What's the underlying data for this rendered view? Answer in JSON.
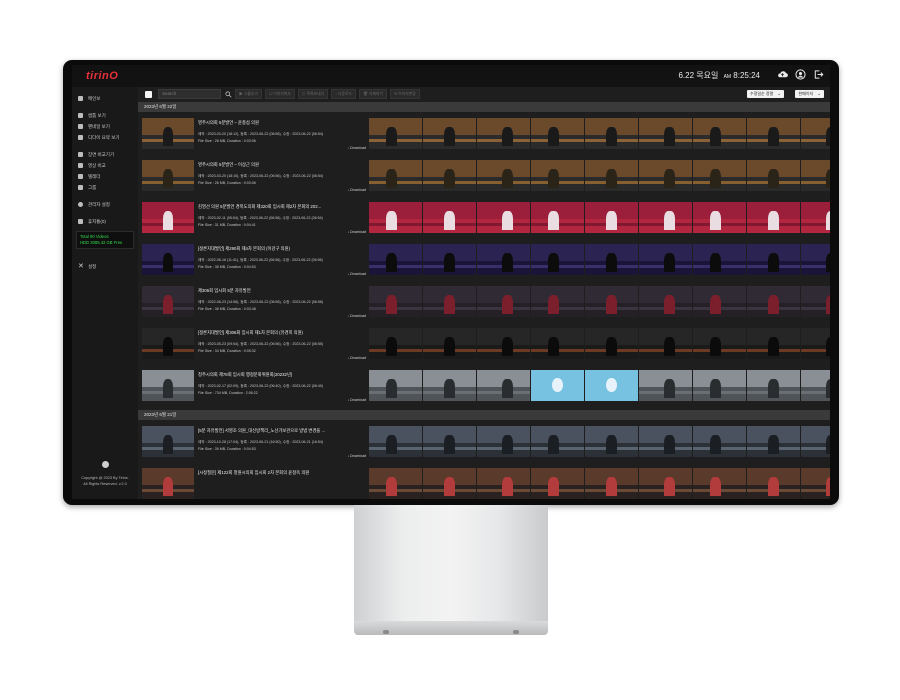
{
  "app": {
    "logo": "tirinO",
    "clock": {
      "date": "6.22 목요일",
      "ampm": "AM",
      "time": "8:25:24"
    }
  },
  "sidebar": {
    "items": [
      {
        "label": "메인보"
      },
      {
        "label": "썸톱 보기"
      },
      {
        "label": "팬네일 보기"
      },
      {
        "label": "디다이 요약 보기"
      },
      {
        "label": "장면 비교기기"
      },
      {
        "label": "영상 비교"
      },
      {
        "label": "텔레더"
      },
      {
        "label": "그룹"
      },
      {
        "label": "관리자 설정"
      },
      {
        "label": "휴지통(0)"
      }
    ],
    "stats": [
      "Total 90 Videos",
      "HDD 3085.42 GB Free"
    ],
    "settings_label": "설정",
    "copyright": [
      "Copyright @ 2023 By Tirins.",
      "All Rights Reserved. v.2.0"
    ]
  },
  "toolbar": {
    "search_placeholder": "Search",
    "buttons": [
      "▶ 그룹추가",
      "☐ 이미지복사",
      "▤ 목록보내기",
      "↓ 다운로드",
      "🗑 삭제하기",
      "⟲ 이미지변경"
    ],
    "sort_select": "수정일순 정렬",
    "view_select": "한페이지"
  },
  "sections": [
    {
      "date": "2023년 6월 22일",
      "rows": [
        {
          "title": "영주시의회 5분발언 – 윤충섭 의원",
          "meta": "제작 : 2023-03-20 (18:12), 등록 : 2023-06-22 (06:56), 수정 : 2023-06-22 (06:54)",
          "size": "File Size : 26 MB, Duration : 0:03:06",
          "download": "↓ Download"
        },
        {
          "title": "영주시의회 5분발언 – 이상근 의원",
          "meta": "제작 : 2023-03-20 (18:10), 등록 : 2023-06-22 (06:56), 수정 : 2023-06-22 (06:54)",
          "size": "File Size : 26 MB, Duration : 0:03:06",
          "download": "↓ Download"
        },
        {
          "title": "김영선 의원 5분발언 경복도의회 제320회 임시회 제2차 본회의 202...",
          "meta": "제작 : 2023-02-11 (05:54), 등록 : 2023-06-22 (06:56), 수정 : 2023-06-22 (06:54)",
          "size": "File Size : 31 MB, Duration : 0:04:41",
          "download": "↓ Download"
        },
        {
          "title": "[정론지대발언] 제290회 제4차 본회의 (이강구 의원)",
          "meta": "제작 : 2022-06-16 (11:41), 등록 : 2023-06-22 (06:56), 수정 : 2023-06-22 (06:56)",
          "size": "File Size : 38 MB, Duration : 0:04:53",
          "download": "↓ Download"
        },
        {
          "title": "제306회 임시회 5분 자유발언",
          "meta": "제작 : 2022-06-23 (14:56), 등록 : 2023-06-22 (06:56), 수정 : 2023-06-22 (06:56)",
          "size": "File Size : 38 MB, Duration : 0:03:48",
          "download": "↓ Download"
        },
        {
          "title": "[정론지대발언] 제306회 임시회 제1차 본회의 (유경희 의원)",
          "meta": "제작 : 2023-05-23 (09:54), 등록 : 2023-06-22 (06:56), 수정 : 2023-06-22 (06:55)",
          "size": "File Size : 34 MB, Duration : 0:05:32",
          "download": "↓ Download"
        },
        {
          "title": "청주시의회 제78회 임시회 행정문화위원회(20232년)",
          "meta": "제작 : 2023-02-17 (02:09), 등록 : 2023-06-22 (06:40), 수정 : 2023-06-22 (06:40)",
          "size": "File Size : 734 MB, Duration : 2:06:22",
          "download": "↓ Download"
        }
      ]
    },
    {
      "date": "2023년 6월 21일",
      "rows": [
        {
          "title": "[5분 자유발언] 서영조 의원_대신방책리_노선가보관으로 방법 변경을 ...",
          "meta": "제작 : 2023-10-28 (17:04), 등록 : 2023-06-21 (16:50), 수정 : 2023-06-21 (16:54)",
          "size": "File Size : 39 MB, Duration : 0:04:53",
          "download": "↓ Download"
        },
        {
          "title": "[시정질문] 제122회 청원시의회 임시회 2차 본회의 윤정옥 의원",
          "meta": "",
          "size": "",
          "download": ""
        }
      ]
    }
  ],
  "colors": {
    "accent": "#e8303a",
    "stats_text": "#35d94b",
    "background": "#1e1e1e"
  }
}
